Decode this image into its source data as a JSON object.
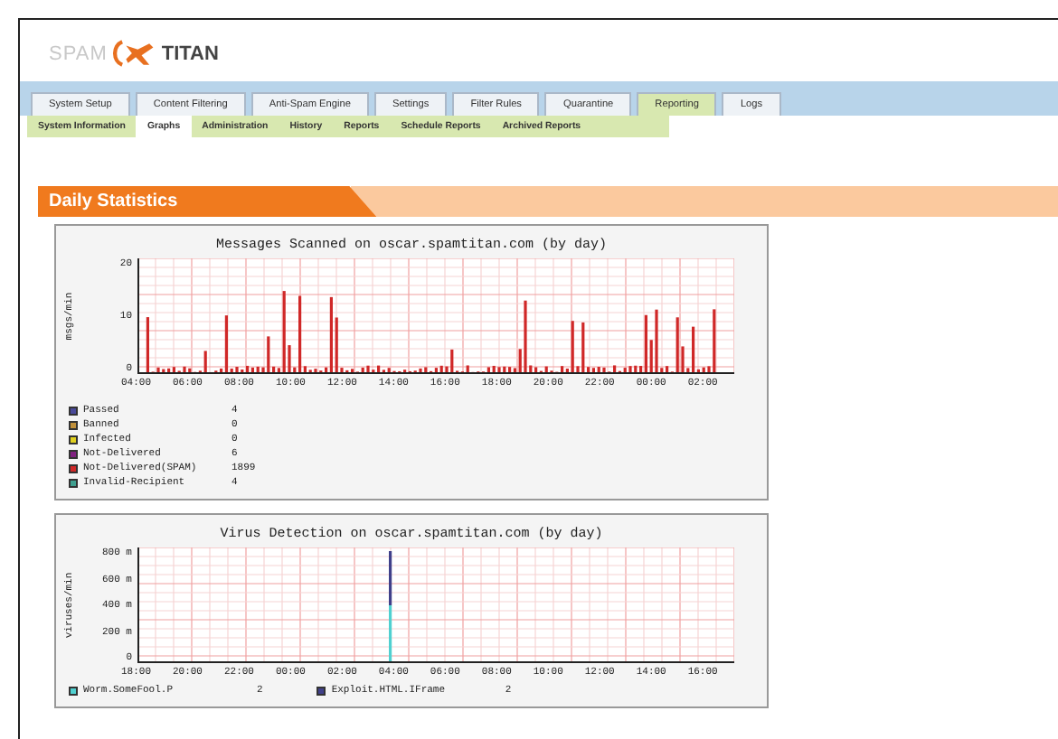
{
  "logo": {
    "left": "SPAM",
    "right": "TITAN"
  },
  "tabs": [
    {
      "label": "System Setup",
      "selected": false
    },
    {
      "label": "Content Filtering",
      "selected": false
    },
    {
      "label": "Anti-Spam Engine",
      "selected": false
    },
    {
      "label": "Settings",
      "selected": false
    },
    {
      "label": "Filter Rules",
      "selected": false
    },
    {
      "label": "Quarantine",
      "selected": false
    },
    {
      "label": "Reporting",
      "selected": true
    },
    {
      "label": "Logs",
      "selected": false
    }
  ],
  "subtabs": [
    {
      "label": "System Information",
      "selected": false
    },
    {
      "label": "Graphs",
      "selected": true
    },
    {
      "label": "Administration",
      "selected": false
    },
    {
      "label": "History",
      "selected": false
    },
    {
      "label": "Reports",
      "selected": false
    },
    {
      "label": "Schedule Reports",
      "selected": false
    },
    {
      "label": "Archived Reports",
      "selected": false
    }
  ],
  "section": {
    "title": "Daily Statistics"
  },
  "graphs": [
    {
      "kind": "traffic",
      "title": "Messages Scanned on oscar.spamtitan.com (by day)",
      "ylabel": "msgs/min",
      "yticks": [
        "20",
        "10",
        "0"
      ],
      "xticks": [
        "04:00",
        "06:00",
        "08:00",
        "10:00",
        "12:00",
        "14:00",
        "16:00",
        "18:00",
        "20:00",
        "22:00",
        "00:00",
        "02:00"
      ],
      "legend": [
        {
          "label": "Passed",
          "value": "4",
          "color": "#4a4a9a"
        },
        {
          "label": "Banned",
          "value": "0",
          "color": "#c0903a"
        },
        {
          "label": "Infected",
          "value": "0",
          "color": "#e0d020"
        },
        {
          "label": "Not-Delivered",
          "value": "6",
          "color": "#802080"
        },
        {
          "label": "Not-Delivered(SPAM)",
          "value": "1899",
          "color": "#d02828"
        },
        {
          "label": "Invalid-Recipient",
          "value": "4",
          "color": "#40a090"
        }
      ]
    },
    {
      "kind": "virus",
      "title": "Virus Detection on oscar.spamtitan.com (by day)",
      "ylabel": "viruses/min",
      "yticks": [
        "800 m",
        "600 m",
        "400 m",
        "200 m",
        "0"
      ],
      "xticks": [
        "18:00",
        "20:00",
        "22:00",
        "00:00",
        "02:00",
        "04:00",
        "06:00",
        "08:00",
        "10:00",
        "12:00",
        "14:00",
        "16:00"
      ],
      "legend": [
        {
          "label": "Worm.SomeFool.P",
          "value": "2",
          "color": "#50d0d0"
        },
        {
          "label": "Exploit.HTML.IFrame",
          "value": "2",
          "color": "#40408a"
        }
      ]
    }
  ]
}
